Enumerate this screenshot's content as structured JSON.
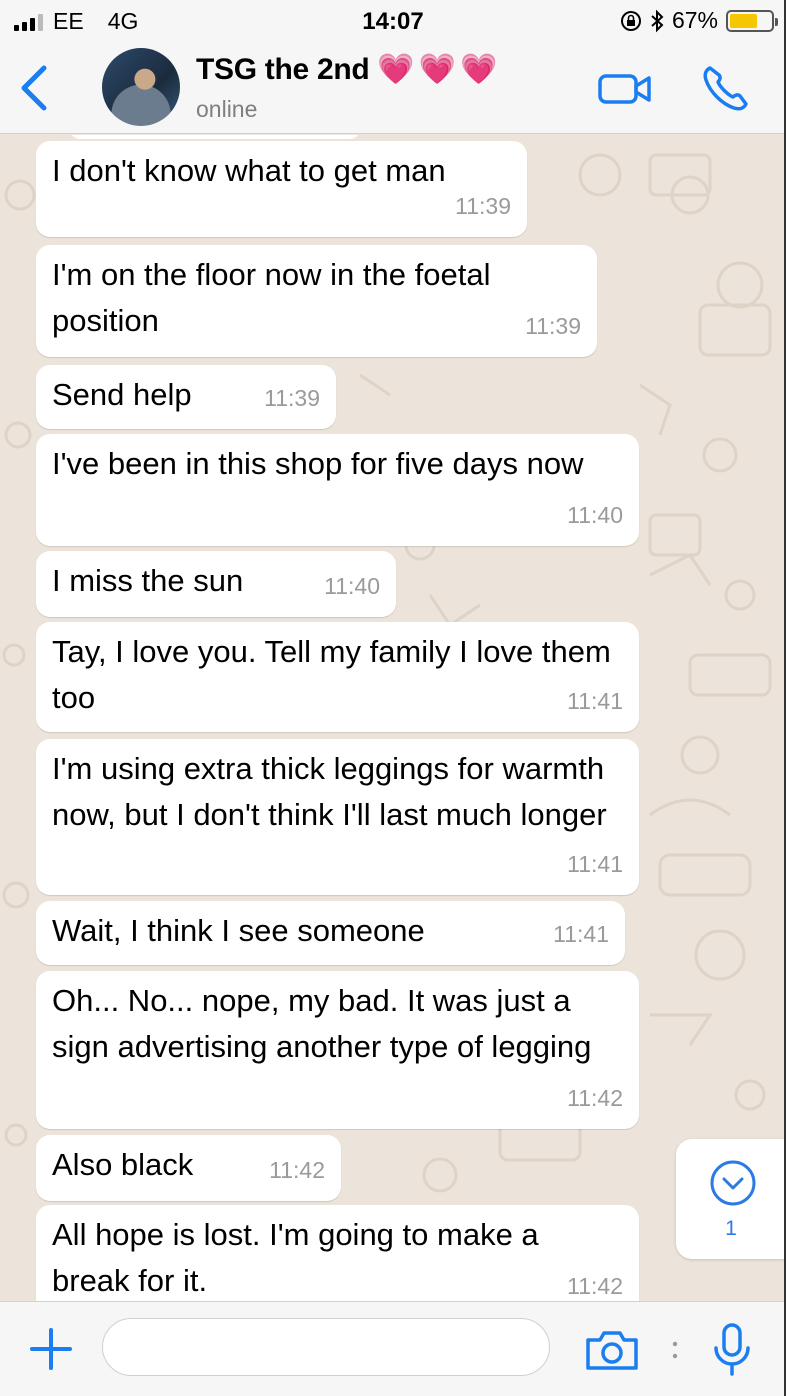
{
  "status_bar": {
    "carrier": "EE",
    "network": "4G",
    "time": "14:07",
    "battery_percent": "67%",
    "battery_level": 0.67
  },
  "header": {
    "contact_name": "TSG the 2nd",
    "contact_emoji": "💗💗💗",
    "contact_status": "online",
    "accent_color": "#1a7ef0"
  },
  "messages": [
    {
      "text": "I don't know what to get man",
      "time": "11:39"
    },
    {
      "text": "I'm on the floor now in the foetal position",
      "time": "11:39"
    },
    {
      "text": "Send help",
      "time": "11:39"
    },
    {
      "text": "I've been in this shop for five days now",
      "time": "11:40"
    },
    {
      "text": "I miss the sun",
      "time": "11:40"
    },
    {
      "text": "Tay, I love you. Tell my family I love them too",
      "time": "11:41"
    },
    {
      "text": "I'm using extra thick leggings for warmth now, but I don't think I'll last much longer",
      "time": "11:41"
    },
    {
      "text": "Wait, I think I see someone",
      "time": "11:41"
    },
    {
      "text": "Oh... No... nope, my bad. It was just a sign advertising another type of legging",
      "time": "11:42"
    },
    {
      "text": "Also black",
      "time": "11:42"
    },
    {
      "text": "All hope is lost. I'm going to make a break for it.",
      "time": "11:42"
    }
  ],
  "scroll_to_bottom": {
    "unread_count": "1"
  },
  "input": {
    "value": "",
    "placeholder": ""
  },
  "icons": {
    "back": "chevron-left-icon",
    "video": "video-camera-icon",
    "call": "phone-icon",
    "plus": "plus-icon",
    "camera": "camera-icon",
    "mic": "microphone-icon",
    "scroll": "chevron-down-icon"
  }
}
